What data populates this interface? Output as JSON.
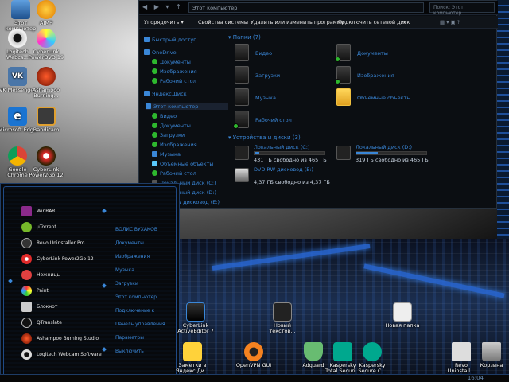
{
  "desktop_icons": [
    {
      "label": "Этот компьютер",
      "icon": "computer-icon"
    },
    {
      "label": "AIMP",
      "icon": "aimp-icon"
    },
    {
      "label": "Logitech Webca...",
      "icon": "webcam-icon"
    },
    {
      "label": "CyberLink PowerDVD 19",
      "icon": "powerdvd-icon"
    },
    {
      "label": "VK Messenger",
      "icon": "vk-icon"
    },
    {
      "label": "Ashampoo Burning...",
      "icon": "ashampoo-icon"
    },
    {
      "label": "Microsoft Edge",
      "icon": "edge-icon"
    },
    {
      "label": "Bandicam",
      "icon": "bandicam-icon"
    },
    {
      "label": "Google Chrome",
      "icon": "chrome-icon"
    },
    {
      "label": "CyberLink Power2Go 12",
      "icon": "power2go-icon"
    },
    {
      "label": "CyberLink ActiveEditor 7",
      "icon": "activeeditor-icon"
    },
    {
      "label": "Новый текстов...",
      "icon": "textfile-icon"
    },
    {
      "label": "Новая папка",
      "icon": "folder-icon"
    },
    {
      "label": "Заметки в Яндекс.Ди...",
      "icon": "notes-icon"
    },
    {
      "label": "OpenVPN GUI",
      "icon": "openvpn-icon"
    },
    {
      "label": "Adguard",
      "icon": "adguard-icon"
    },
    {
      "label": "Kaspersky Total Securi...",
      "icon": "kaspersky-total-icon"
    },
    {
      "label": "Kaspersky Secure C...",
      "icon": "kaspersky-secure-icon"
    },
    {
      "label": "Revo Uninstall...",
      "icon": "revo-icon"
    },
    {
      "label": "Корзина",
      "icon": "recycle-bin-icon"
    }
  ],
  "explorer": {
    "address": "Этот компьютер",
    "search_placeholder": "Поиск: Этот компьютер",
    "toolbar": [
      "Упорядочить ▾",
      "Свойства системы",
      "Удалить или изменить программу",
      "Подключить сетевой диск",
      "»"
    ],
    "nav_items": [
      "Быстрый доступ",
      "OneDrive",
      "Документы",
      "Изображения",
      "Рабочий стол",
      "Яндекс.Диск",
      "Этот компьютер",
      "Видео",
      "Документы",
      "Загрузки",
      "Изображения",
      "Музыка",
      "Объемные объекты",
      "Рабочий стол",
      "Локальный диск (C:)",
      "Локальный диск (D:)",
      "DVD RW дисковод (E:)"
    ],
    "folders_header": "Папки (7)",
    "folders": [
      "Видео",
      "Документы",
      "Загрузки",
      "Изображения",
      "Музыка",
      "Объемные объекты",
      "Рабочий стол"
    ],
    "drives_header": "Устройства и диски (3)",
    "drives": [
      {
        "name": "Локальный диск (C:)",
        "free": "431 ГБ свободно из 465 ГБ",
        "used_fraction": 0.07
      },
      {
        "name": "Локальный диск (D:)",
        "free": "319 ГБ свободно из 465 ГБ",
        "used_fraction": 0.31
      },
      {
        "name": "DVD RW дисковод (E:)",
        "free": "4,37 ГБ свободно из 4,37 ГБ"
      }
    ]
  },
  "start_menu": {
    "left_items": [
      "WinRAR",
      "µTorrent",
      "Revo Uninstaller Pro",
      "CyberLink Power2Go 12",
      "Ножницы",
      "Paint",
      "Блокнот",
      "QTranslate",
      "Ashampoo Burning Studio",
      "Logitech Webcam Software"
    ],
    "right_items": [
      "ВОЛИС ВУХАКОВ",
      "Документы",
      "Изображения",
      "Музыка",
      "Загрузки",
      "Этот компьютер",
      "Подключение к",
      "Панель управления",
      "Параметры",
      "Выключить"
    ]
  },
  "taskbar": {
    "clock": "16:04"
  },
  "colors": {
    "accent": "#3a87d8",
    "window_bg": "#0b0e12",
    "check": "#2eb82e"
  }
}
